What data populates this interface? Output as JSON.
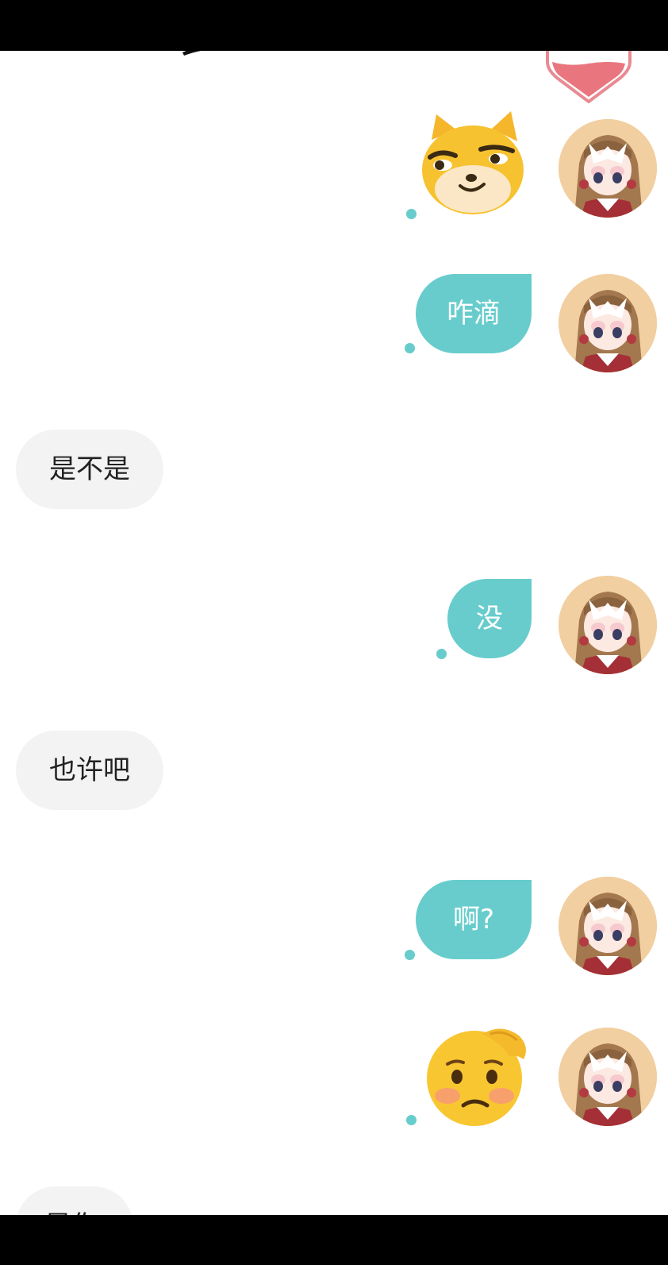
{
  "conversation": {
    "messages": [
      {
        "side": "out",
        "kind": "sticker",
        "sticker": "smug-cat-sticker"
      },
      {
        "side": "out",
        "kind": "text",
        "text": "咋滴"
      },
      {
        "side": "in",
        "kind": "text",
        "text": "是不是"
      },
      {
        "side": "out",
        "kind": "text",
        "text": "没"
      },
      {
        "side": "in",
        "kind": "text",
        "text": "也许吧"
      },
      {
        "side": "out",
        "kind": "text",
        "text": "啊?"
      },
      {
        "side": "out",
        "kind": "sticker",
        "sticker": "embarrassed-face-sticker"
      },
      {
        "side": "in",
        "kind": "text-partial",
        "text": "是你"
      }
    ]
  },
  "icons": {
    "avatar": "anime-girl-avatar-icon",
    "heart": "heart-icon",
    "read_indicator": "read-dot-icon"
  },
  "colors": {
    "outgoing_bubble": "#68cccc",
    "incoming_bubble": "#f3f3f3",
    "heart": "#e87b86"
  }
}
